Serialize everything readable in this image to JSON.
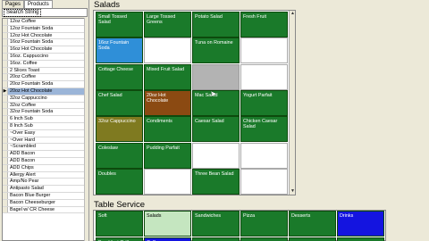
{
  "tabs": [
    "Pages",
    "Products"
  ],
  "search_label": "Search String",
  "items": [
    "12oz Coffee",
    "12oz Fountain Soda",
    "12oz Hot Chocolate",
    "16oz Fountain Soda",
    "16oz Hot Chocolate",
    "16oz. Cappuccino",
    "16oz. Coffee",
    "2 Slices Toast",
    "20oz Coffee",
    "20oz Fountain Soda",
    "20oz Hot Chocolate",
    "32oz Cappuccino",
    "32oz Coffee",
    "32oz Fountain Soda",
    "6 Inch Sub",
    "8 Inch Sub",
    "~Over Easy",
    "~Over Hard",
    "~Scrambled",
    "ADD Bacon",
    "ADD Bacon",
    "ADD Chips",
    "Allergy Alert",
    "Amp/No Pear",
    "Antipasto Salad",
    "Bacon Blue Burger",
    "Bacon Cheeseburger",
    "Bagel w/ CR Cheese"
  ],
  "salads_title": "Salads",
  "salads": [
    [
      "Small Tossed Salad",
      "Large Tossed Greens",
      "Potato Salad",
      "Fresh Fruit"
    ],
    [
      "16oz Fountain Soda",
      "",
      "Tuna on Romaine",
      ""
    ],
    [
      "Cottage Cheese",
      "Mixed Fruit Salad",
      "",
      ""
    ],
    [
      "Chef Salad",
      "20oz Hot Chocolate",
      "Mac Salad",
      "Yogurt Parfait"
    ],
    [
      "32oz Cappuccino",
      "Condiments",
      "Caesar Salad",
      "Chicken Caesar Salad"
    ],
    [
      "Coleslaw",
      "Pudding Parfait",
      "",
      ""
    ],
    [
      "Doubles",
      "",
      "Three Bean Salad",
      ""
    ]
  ],
  "table_service_title": "Table Service",
  "table_service": [
    "Soft",
    "Salads",
    "Sandwiches",
    "Pizza",
    "Desserts",
    "Drinks"
  ],
  "table_service_row2": [
    "Breakfast Grill",
    "Coffee",
    "",
    "",
    "",
    ""
  ]
}
